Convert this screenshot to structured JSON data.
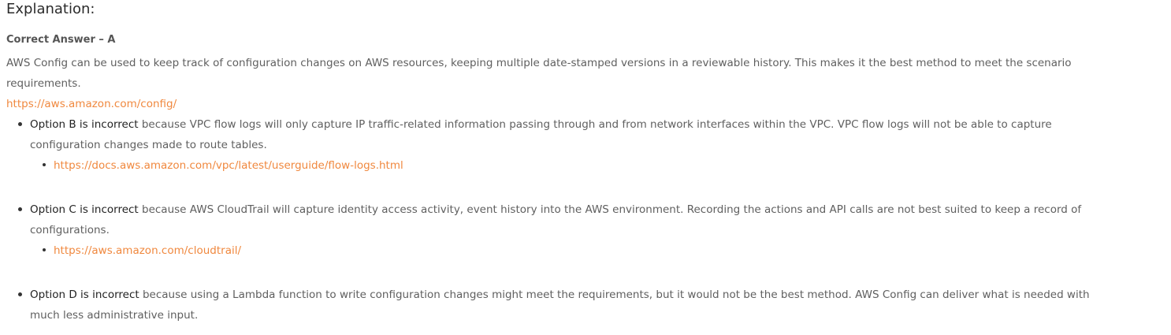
{
  "heading": "Explanation:",
  "correct_answer": "Correct Answer – A",
  "intro": "AWS Config can be used to keep track of configuration changes on AWS resources, keeping multiple date-stamped versions in a reviewable history. This makes it the best method to meet the scenario requirements.",
  "main_link": "https://aws.amazon.com/config/",
  "options": [
    {
      "lead": "Option B is incorrect",
      "text": " because VPC flow logs will only capture IP traffic-related information passing through and from network interfaces within the VPC. VPC flow logs will not be able to capture configuration changes made to route tables.",
      "link": "https://docs.aws.amazon.com/vpc/latest/userguide/flow-logs.html"
    },
    {
      "lead": "Option C is incorrect",
      "text": " because AWS CloudTrail will capture identity access activity, event history into the AWS environment. Recording the actions and API calls are not best suited to keep a record of configurations.",
      "link": "https://aws.amazon.com/cloudtrail/"
    },
    {
      "lead": "Option D is incorrect",
      "text": " because using a Lambda function to write configuration changes might meet the requirements, but it would not be the best method. AWS Config can deliver what is needed with much less administrative input."
    }
  ],
  "colors": {
    "link": "#f0883e",
    "text": "#5f5f5f",
    "heading": "#2b2b2b"
  }
}
